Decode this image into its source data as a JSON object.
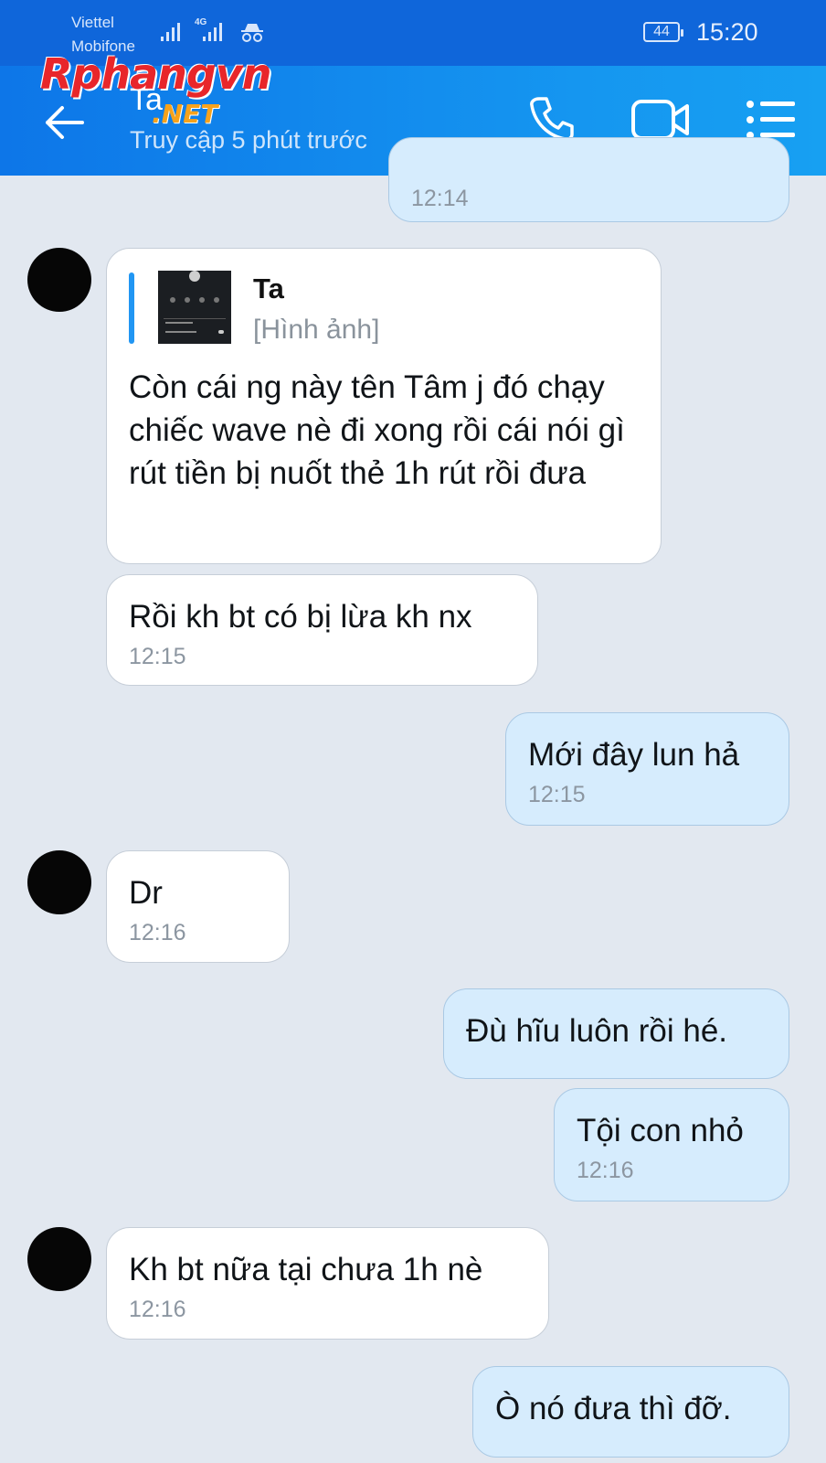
{
  "status_bar": {
    "carrier_1": "Viettel",
    "carrier_2": "Mobifone",
    "network": "4G",
    "battery": "44",
    "time": "15:20"
  },
  "header": {
    "contact_name": "Ta",
    "last_seen": "Truy cập 5 phút trước",
    "watermark_main": "Rphangvn",
    "watermark_sub": ".NET"
  },
  "messages": [
    {
      "side": "out",
      "text": "",
      "time": "12:14"
    },
    {
      "side": "in",
      "quote_name": "Ta",
      "quote_text": "[Hình ảnh]",
      "text": "Còn cái ng  này tên Tâm j đó chạy chiếc wave nè đi xong rồi cái nói gì rút tiền bị nuốt thẻ 1h rút rồi đưa",
      "time": ""
    },
    {
      "side": "in",
      "text": "Rồi kh bt có bị lừa kh nx",
      "time": "12:15"
    },
    {
      "side": "out",
      "text": "Mới đây lun hả",
      "time": "12:15"
    },
    {
      "side": "in",
      "text": "Dr",
      "time": "12:16"
    },
    {
      "side": "out",
      "text": "Đù hĩu luôn rồi hé.",
      "time": ""
    },
    {
      "side": "out",
      "text": "Tội con nhỏ",
      "time": "12:16"
    },
    {
      "side": "in",
      "text": "Kh bt nữa tại chưa 1h nè",
      "time": "12:16"
    },
    {
      "side": "out",
      "text": "Ò nó đưa thì đỡ.",
      "time": ""
    }
  ],
  "colors": {
    "header_bg": "#1596f0",
    "statusbar_bg": "#0f66da",
    "chat_bg": "#e2e8f0",
    "incoming_bubble": "#ffffff",
    "outgoing_bubble": "#d6ecfd",
    "quote_accent": "#2196f3"
  },
  "icons": [
    "signal-icon",
    "incognito-icon",
    "battery-icon",
    "back-arrow-icon",
    "phone-call-icon",
    "video-call-icon",
    "menu-list-icon"
  ]
}
